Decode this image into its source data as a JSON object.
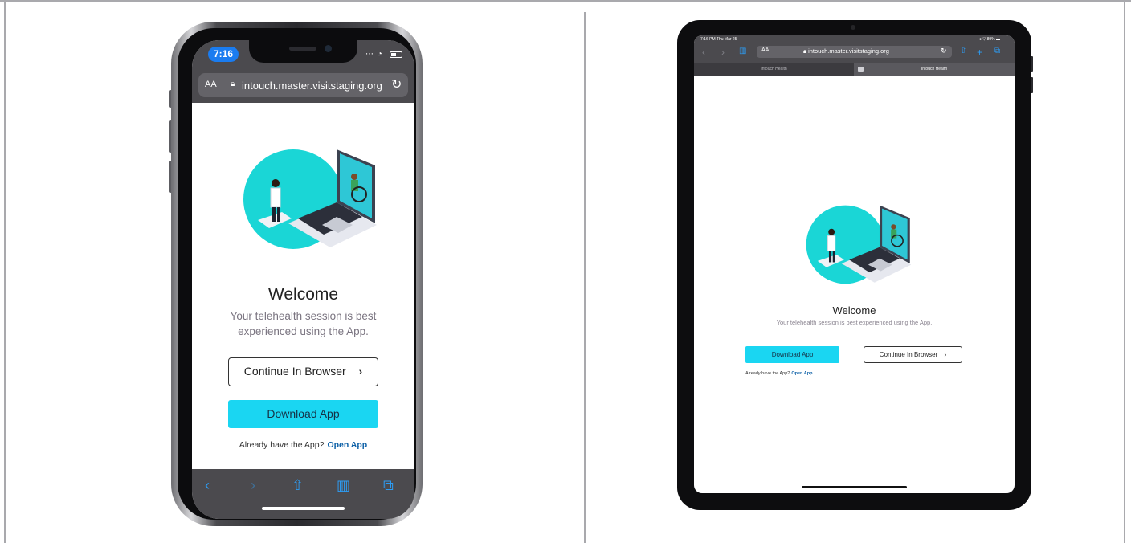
{
  "phone": {
    "time": "7:16",
    "aa": "AA",
    "url": "intouch.master.visitstaging.org",
    "welcome": "Welcome",
    "subtitle": "Your telehealth session is best experienced using the App.",
    "continue_label": "Continue In Browser",
    "continue_chevron": "›",
    "download_label": "Download App",
    "already_text": "Already have the App?",
    "open_app_label": "Open App"
  },
  "tablet": {
    "status_left": "7:16 PM  Thu Mar 25",
    "status_right": "● ▽ 89% ▬",
    "aa": "AA",
    "url": "intouch.master.visitstaging.org",
    "tab1": "Intouch Health",
    "tab2": "Intouch Health",
    "welcome": "Welcome",
    "subtitle": "Your telehealth session is best experienced using the App.",
    "download_label": "Download App",
    "continue_label": "Continue In Browser",
    "continue_chevron": "›",
    "already_text": "Already have the App?",
    "open_app_label": "Open App"
  },
  "colors": {
    "accent": "#1ad6f2",
    "link": "#0f62a8",
    "browser_chrome": "#4b4a4e",
    "ios_blue": "#2d9cf3"
  },
  "icons": {
    "lock": "lock-icon",
    "reload": "reload-icon",
    "back": "back-icon",
    "forward": "forward-icon",
    "share": "share-icon",
    "bookmarks": "bookmarks-icon",
    "tabs": "tabs-icon",
    "plus": "plus-icon"
  }
}
